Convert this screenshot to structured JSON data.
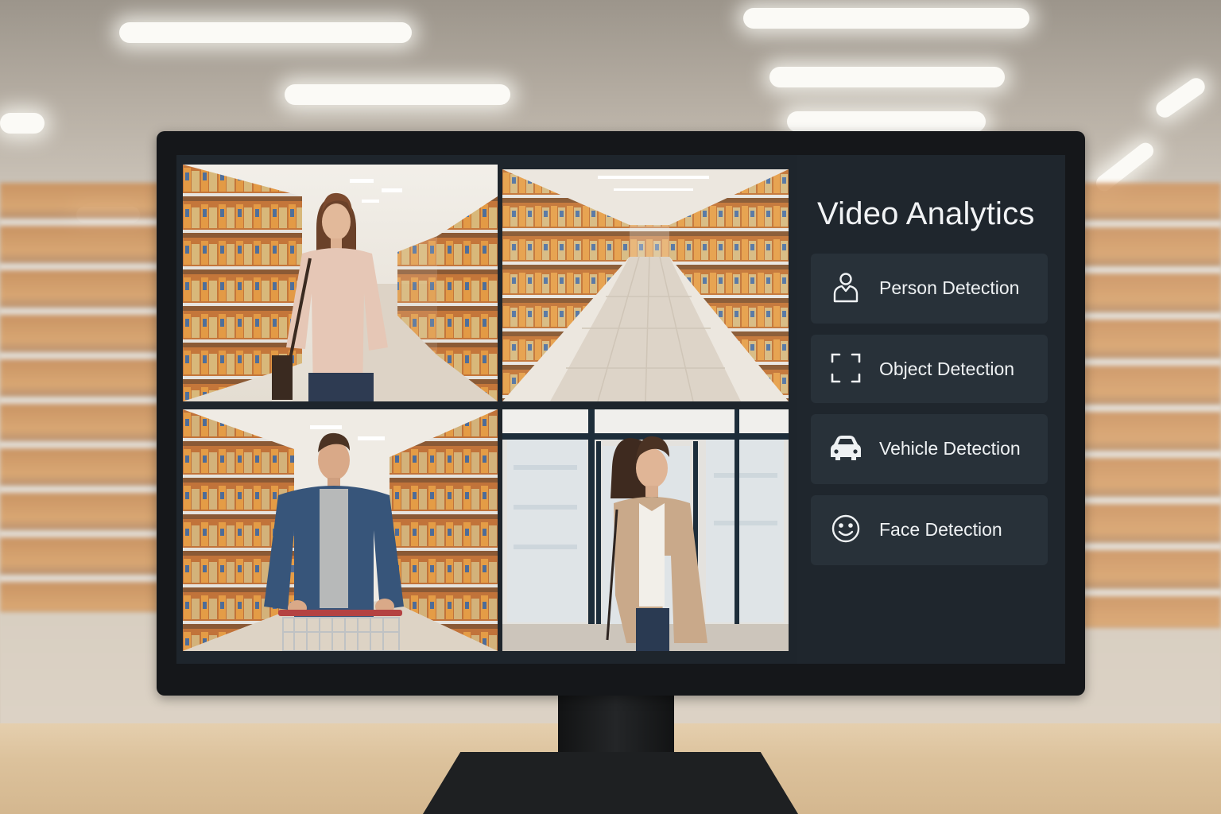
{
  "panel": {
    "title": "Video Analytics",
    "items": [
      {
        "label": "Person Detection",
        "icon": "person-icon"
      },
      {
        "label": "Object Detection",
        "icon": "object-frame-icon"
      },
      {
        "label": "Vehicle Detection",
        "icon": "car-icon"
      },
      {
        "label": "Face Detection",
        "icon": "smiley-face-icon"
      }
    ]
  },
  "feeds": [
    {
      "name": "camera-feed-1",
      "subject": "woman in pink sweater in aisle"
    },
    {
      "name": "camera-feed-2",
      "subject": "empty store aisle"
    },
    {
      "name": "camera-feed-3",
      "subject": "man pushing shopping cart"
    },
    {
      "name": "camera-feed-4",
      "subject": "woman in beige coat near entrance"
    }
  ],
  "colors": {
    "panel_bg": "#1f262d",
    "item_bg": "#283139",
    "text": "#eef1f3"
  }
}
